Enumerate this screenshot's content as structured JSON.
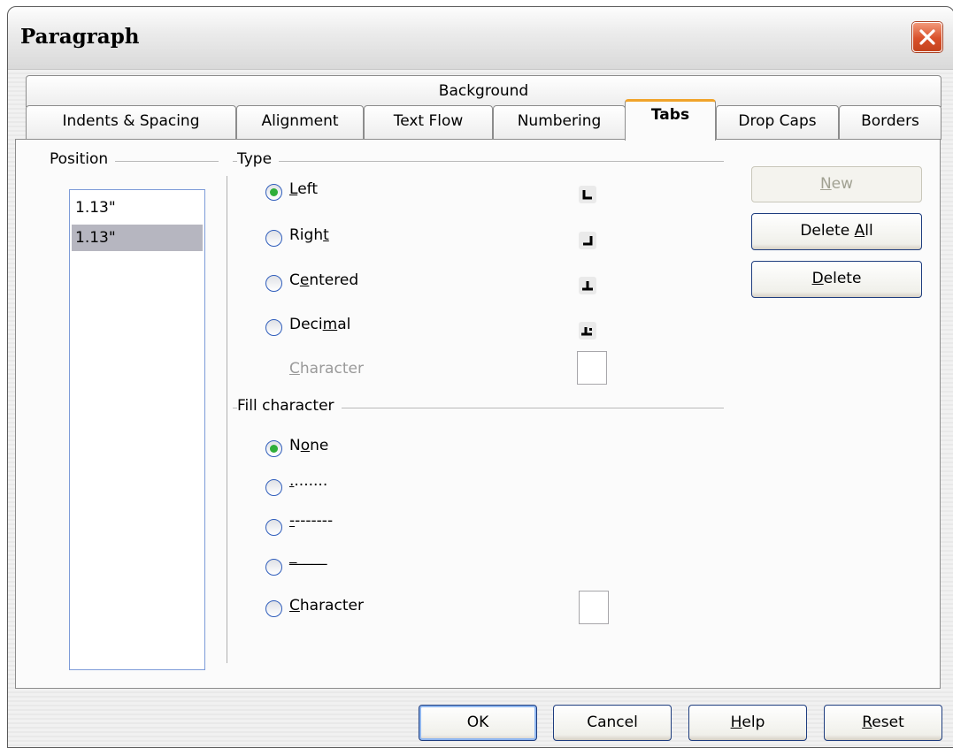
{
  "window": {
    "title": "Paragraph"
  },
  "tabs": {
    "row_back": [
      "Background"
    ],
    "row_front": [
      "Indents & Spacing",
      "Alignment",
      "Text Flow",
      "Numbering",
      "Tabs",
      "Drop Caps",
      "Borders"
    ],
    "active": "Tabs"
  },
  "position": {
    "label": "Position",
    "input_value": "1.13\"",
    "items": [
      "1.13\""
    ],
    "selected_index": 0
  },
  "type": {
    "label": "Type",
    "options": [
      {
        "pre": "",
        "key": "L",
        "post": "eft",
        "checked": true,
        "icon": "left-tab-icon"
      },
      {
        "pre": "Righ",
        "key": "t",
        "post": "",
        "checked": false,
        "icon": "right-tab-icon"
      },
      {
        "pre": "C",
        "key": "e",
        "post": "ntered",
        "checked": false,
        "icon": "centered-tab-icon"
      },
      {
        "pre": "Deci",
        "key": "m",
        "post": "al",
        "checked": false,
        "icon": "decimal-tab-icon"
      }
    ],
    "character": {
      "pre": "",
      "key": "C",
      "post": "haracter",
      "value": ""
    }
  },
  "fill": {
    "label": "Fill character",
    "options": [
      {
        "pre": "N",
        "key": "o",
        "post": "ne",
        "checked": true
      },
      {
        "pre": "",
        "key": ".",
        "post": ".......",
        "checked": false
      },
      {
        "pre": "",
        "key": "-",
        "post": "-------",
        "checked": false
      },
      {
        "pre": "",
        "key": "_",
        "post": "____",
        "checked": false
      },
      {
        "pre": "",
        "key": "C",
        "post": "haracter",
        "checked": false
      }
    ],
    "character_value": ""
  },
  "side_buttons": [
    {
      "pre": "",
      "key": "N",
      "post": "ew",
      "enabled": false
    },
    {
      "pre": "Delete ",
      "key": "A",
      "post": "ll",
      "enabled": true
    },
    {
      "pre": "",
      "key": "D",
      "post": "elete",
      "enabled": true
    }
  ],
  "footer_buttons": [
    {
      "pre": "OK",
      "key": "",
      "post": ""
    },
    {
      "pre": "Cancel",
      "key": "",
      "post": ""
    },
    {
      "pre": "",
      "key": "H",
      "post": "elp"
    },
    {
      "pre": "",
      "key": "R",
      "post": "eset"
    }
  ],
  "colors": {
    "tab_accent": "#f0a32a",
    "radio_dot": "#2fae3a",
    "close_button": "#d9502a",
    "selection": "#b6b6c0"
  }
}
